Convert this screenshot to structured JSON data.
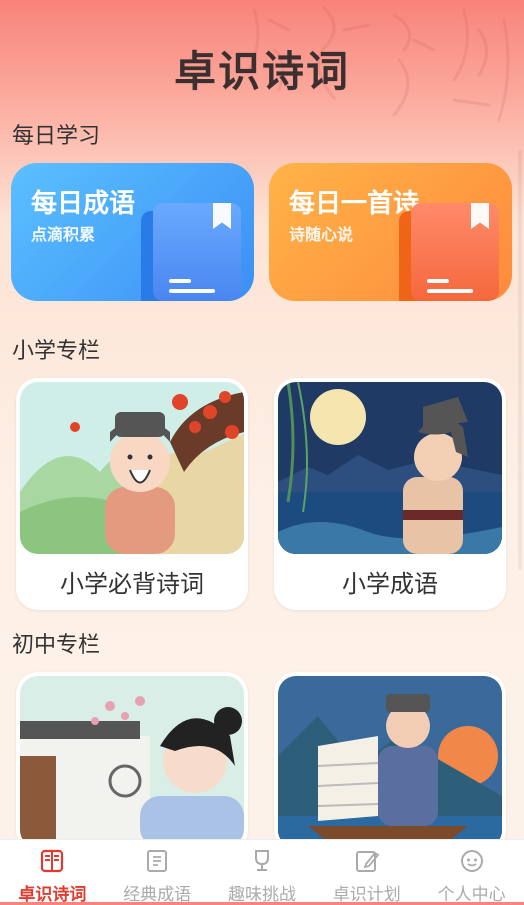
{
  "header": {
    "title": "卓识诗词"
  },
  "sections": {
    "daily": "每日学习",
    "primary": "小学专栏",
    "middle": "初中专栏"
  },
  "daily_cards": [
    {
      "title": "每日成语",
      "subtitle": "点滴积累",
      "color": "#4aa7fb"
    },
    {
      "title": "每日一首诗",
      "subtitle": "诗随心说",
      "color": "#fd9a4c"
    }
  ],
  "primary_cards": [
    {
      "label": "小学必背诗词"
    },
    {
      "label": "小学成语"
    }
  ],
  "tabbar": {
    "items": [
      {
        "label": "卓识诗词",
        "icon": "book-open-icon",
        "active": true
      },
      {
        "label": "经典成语",
        "icon": "idiom-book-icon",
        "active": false
      },
      {
        "label": "趣味挑战",
        "icon": "trophy-icon",
        "active": false
      },
      {
        "label": "卓识计划",
        "icon": "plan-edit-icon",
        "active": false
      },
      {
        "label": "个人中心",
        "icon": "face-icon",
        "active": false
      }
    ]
  },
  "colors": {
    "accent": "#e23a2e",
    "inactive": "#aaaaaa"
  }
}
